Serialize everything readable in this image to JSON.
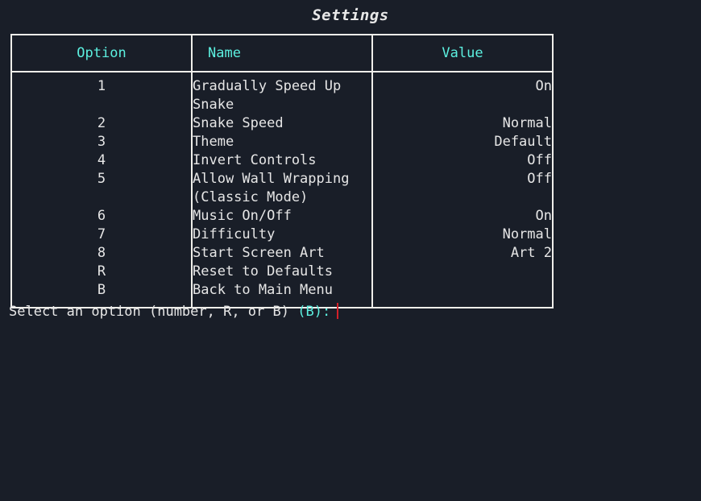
{
  "screen": {
    "title": "Settings",
    "background_color": "#191e28",
    "border_color": "#efeeea",
    "accent_color": "#5cf0e0",
    "text_color": "#e6e6e6",
    "cursor_color": "#d42029"
  },
  "table": {
    "headers": {
      "option": "Option",
      "name": "Name",
      "value": "Value"
    },
    "rows": [
      {
        "option": "1",
        "name": "Gradually Speed Up Snake",
        "value": "On"
      },
      {
        "option": "2",
        "name": "Snake Speed",
        "value": "Normal"
      },
      {
        "option": "3",
        "name": "Theme",
        "value": "Default"
      },
      {
        "option": "4",
        "name": "Invert Controls",
        "value": "Off"
      },
      {
        "option": "5",
        "name": "Allow Wall Wrapping (Classic Mode)",
        "value": "Off"
      },
      {
        "option": "6",
        "name": "Music On/Off",
        "value": "On"
      },
      {
        "option": "7",
        "name": "Difficulty",
        "value": "Normal"
      },
      {
        "option": "8",
        "name": "Start Screen Art",
        "value": "Art 2"
      },
      {
        "option": "R",
        "name": "Reset to Defaults",
        "value": ""
      },
      {
        "option": "B",
        "name": "Back to Main Menu",
        "value": ""
      }
    ]
  },
  "prompt": {
    "text": "Select an option (number, R, or B) ",
    "default_hint": "(B):",
    "input_value": ""
  }
}
